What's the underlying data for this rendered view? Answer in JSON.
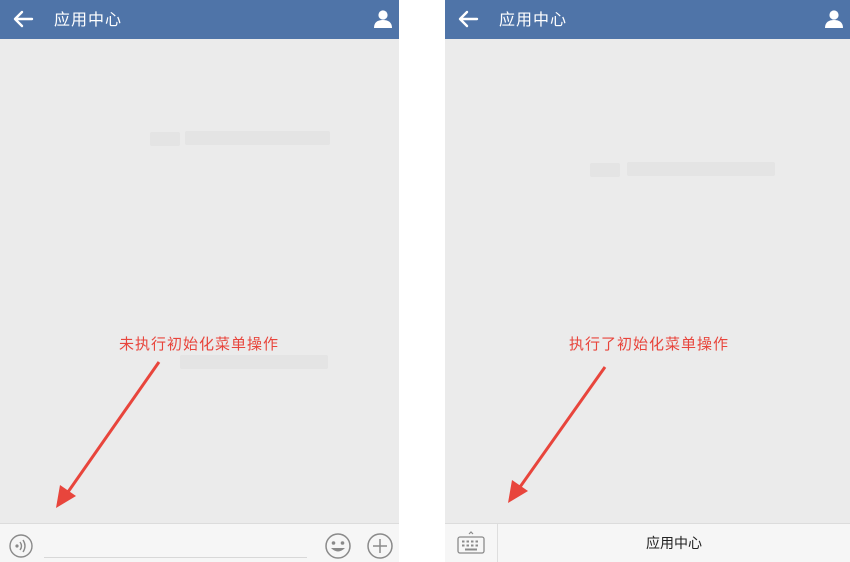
{
  "colors": {
    "topbar": "#4f74a8",
    "annotation": "#e8453c",
    "background": "#ebebeb"
  },
  "left_screen": {
    "title": "应用中心",
    "annotation": "未执行初始化菜单操作",
    "icons": {
      "back": "arrow-left-icon",
      "user": "user-icon",
      "voice": "voice-icon",
      "emoji": "emoji-icon",
      "add": "plus-icon"
    }
  },
  "right_screen": {
    "title": "应用中心",
    "annotation": "执行了初始化菜单操作",
    "menu_item": "应用中心",
    "icons": {
      "back": "arrow-left-icon",
      "user": "user-icon",
      "keyboard": "keyboard-icon"
    }
  }
}
